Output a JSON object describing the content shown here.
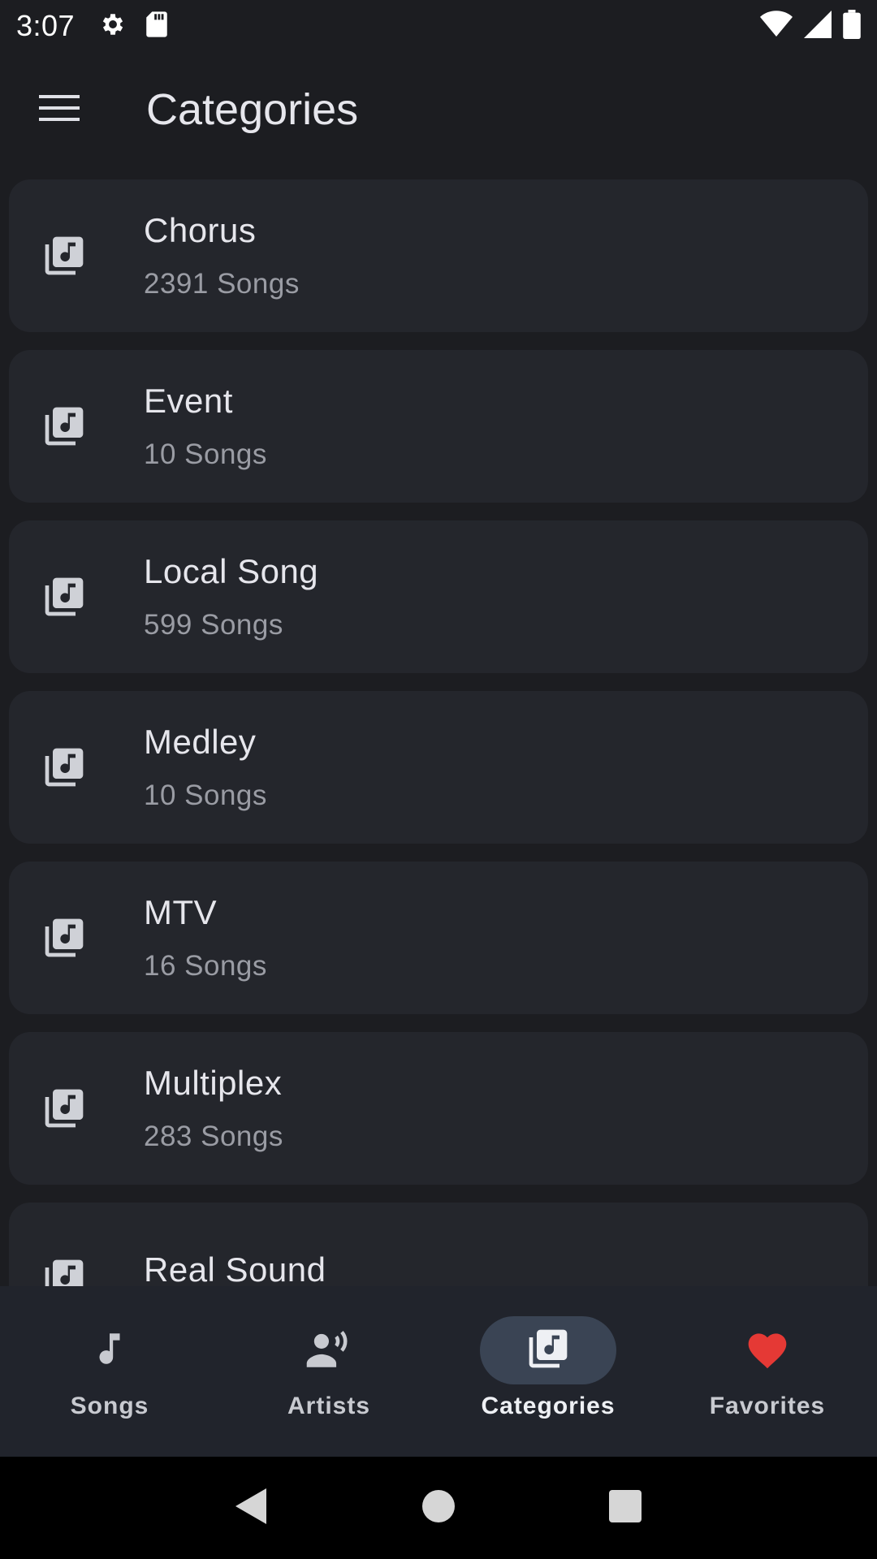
{
  "status_bar": {
    "time": "3:07",
    "icons_left": [
      "settings-icon",
      "sd-card-icon"
    ],
    "icons_right": [
      "wifi-icon",
      "signal-icon",
      "battery-icon"
    ]
  },
  "app_bar": {
    "menu_icon": "hamburger-menu-icon",
    "title": "Categories"
  },
  "categories": [
    {
      "name": "Chorus",
      "count": "2391 Songs"
    },
    {
      "name": "Event",
      "count": "10 Songs"
    },
    {
      "name": "Local Song",
      "count": "599 Songs"
    },
    {
      "name": "Medley",
      "count": "10 Songs"
    },
    {
      "name": "MTV",
      "count": "16 Songs"
    },
    {
      "name": "Multiplex",
      "count": "283 Songs"
    },
    {
      "name": "Real Sound",
      "count": ""
    }
  ],
  "bottom_nav": {
    "items": [
      {
        "label": "Songs",
        "icon": "music-note-icon",
        "active": false
      },
      {
        "label": "Artists",
        "icon": "artist-speaking-icon",
        "active": false
      },
      {
        "label": "Categories",
        "icon": "library-music-icon",
        "active": true
      },
      {
        "label": "Favorites",
        "icon": "heart-icon",
        "active": false
      }
    ]
  },
  "colors": {
    "background": "#1c1d21",
    "card": "#24262c",
    "nav_background": "#21242c",
    "active_pill": "#3a4454",
    "favorite_heart": "#e53935"
  },
  "system_nav": {
    "buttons": [
      "back-icon",
      "home-icon",
      "recents-icon"
    ]
  }
}
